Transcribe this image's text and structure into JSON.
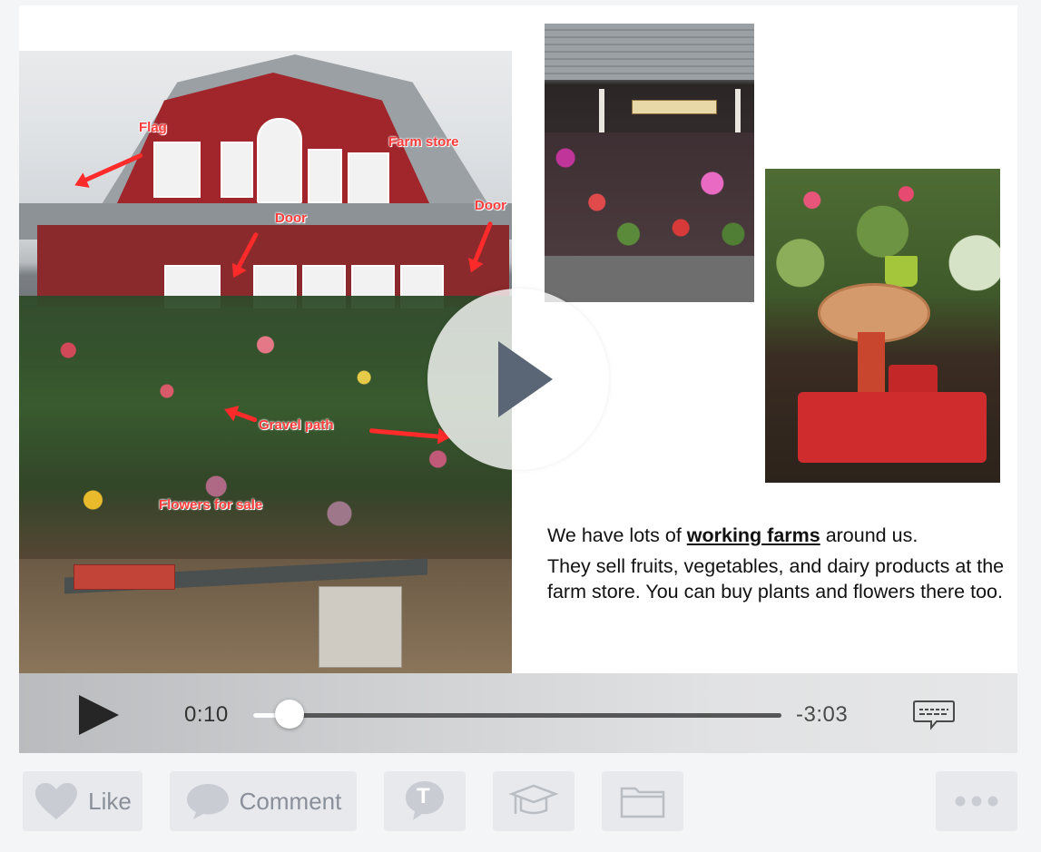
{
  "slide": {
    "annotations": {
      "flag": "Flag",
      "farm_store": "Farm store",
      "door_left": "Door",
      "door_right": "Door",
      "gravel_path": "Gravel path",
      "flowers": "Flowers for sale"
    },
    "caption": {
      "line1_pre": "We have lots of ",
      "line1_em": "working farms",
      "line1_post": " around us.",
      "paragraph2": "They sell fruits, vegetables, and dairy products at the farm store.  You can buy plants and flowers there too."
    }
  },
  "player": {
    "elapsed": "0:10",
    "remaining": "-3:03",
    "progress": 0.069
  },
  "actions": {
    "like": "Like",
    "comment": "Comment",
    "tag_letter": "T"
  },
  "colors": {
    "annotation": "#ff3b3b",
    "barn_red": "#a0262b",
    "action_gray": "#e7e9ec"
  }
}
